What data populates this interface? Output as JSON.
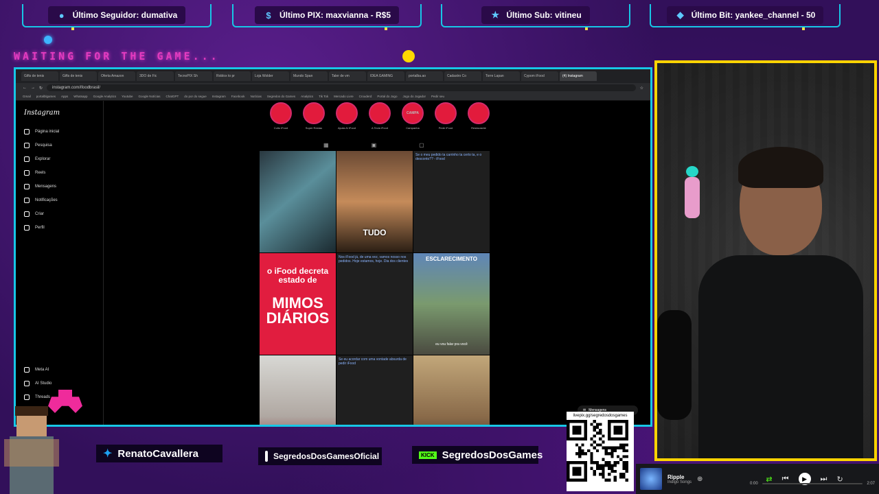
{
  "alerts": [
    {
      "icon": "user-icon",
      "label": "Último Seguidor: dumativa"
    },
    {
      "icon": "dollar-icon",
      "label": "Último PIX: maxvianna - R$5"
    },
    {
      "icon": "star-icon",
      "label": "Último Sub: vitineu"
    },
    {
      "icon": "diamond-icon",
      "label": "Último Bit: yankee_channel - 50"
    }
  ],
  "waiting_text": "WAITING FOR THE GAME...",
  "browser": {
    "tabs": [
      "Gifts de tenis",
      "Gifts de tenis",
      "Oferta Amazon",
      "3DO de Fic",
      "TecnoPIX Sh",
      "Roblox to pr",
      "Loja Wolder",
      "Mundo Span",
      "Taler de vm",
      "IDEA GAMING",
      "portalba.ao",
      "Cadastro Co",
      "Torre Lapan",
      "Cypom iFood",
      "(4) Instagram"
    ],
    "url": "instagram.com/ifoodbrasil/",
    "bookmarks": [
      "Gmail",
      "portalblgames",
      "Apps",
      "Whatsapp",
      "Google Analytics",
      "Youtube",
      "Google Notícias",
      "ChatGPT",
      "do por do segue",
      "Instagram",
      "Facebook",
      "Notícias",
      "Segredos do Games",
      "Analytics",
      "Tik Tok",
      "Mercado Livre",
      "Crouderd",
      "Portal do Jogo",
      "Jogo do Jogador",
      "Pedir seu"
    ]
  },
  "instagram": {
    "logo": "Instagram",
    "nav": [
      {
        "icon": "home-icon",
        "label": "Página inicial"
      },
      {
        "icon": "search-icon",
        "label": "Pesquisa"
      },
      {
        "icon": "compass-icon",
        "label": "Explorar"
      },
      {
        "icon": "reels-icon",
        "label": "Reels"
      },
      {
        "icon": "message-icon",
        "label": "Mensagens"
      },
      {
        "icon": "heart-icon",
        "label": "Notificações"
      },
      {
        "icon": "plus-icon",
        "label": "Criar"
      },
      {
        "icon": "profile-icon",
        "label": "Perfil"
      }
    ],
    "nav_bottom": [
      {
        "icon": "meta-ai-icon",
        "label": "Meta AI"
      },
      {
        "icon": "ai-studio-icon",
        "label": "AI Studio"
      },
      {
        "icon": "threads-icon",
        "label": "Threads"
      }
    ],
    "stories": [
      "Culto iFood",
      "Super Restau",
      "Ajuda AI iFood",
      "A Tecla iFood",
      "Campanha",
      "Pede iFood",
      "Restaurante"
    ],
    "story_badges": [
      "",
      "",
      "",
      "",
      "CAMPA",
      "",
      ""
    ],
    "posts": [
      {
        "kind": "image",
        "caption": ""
      },
      {
        "kind": "image",
        "caption": "TUDO"
      },
      {
        "kind": "text",
        "caption": "Se o meu pedido ta carrinho ta certo ta, e o desconto?? - iFood"
      },
      {
        "kind": "text-big",
        "line1": "o iFood decreta estado de",
        "line2": "MIMOS DIÁRIOS"
      },
      {
        "kind": "text",
        "caption": "Nos iFood já, de uma vez, vamos nosso nos pedidos. Hoje estamos, hoje. Dia dos clientes"
      },
      {
        "kind": "image",
        "caption": "ESCLARECIMENTO",
        "subtitle": "eu vou falar pra você"
      },
      {
        "kind": "image",
        "caption": ""
      },
      {
        "kind": "text",
        "caption": "Se eu acordar com uma vontade absurda de pedir iFood"
      },
      {
        "kind": "image",
        "caption": ""
      }
    ],
    "messages_label": "Mensagens"
  },
  "socials": {
    "twitter": "RenatoCavallera",
    "instagram": "SegredosDosGamesOficial",
    "kick_logo": "KICK",
    "kick": "SegredosDosGames"
  },
  "qr_url": "livepix.gg/segredosdosgames",
  "player": {
    "title": "Ripple",
    "artist": "Indigo Songs",
    "current": "0:00",
    "total": "2:07",
    "progress": 0
  },
  "colors": {
    "frame": "#17c7e6",
    "cam_border": "#ffd400",
    "accent_pink": "#e23bbf",
    "ifood_red": "#e11d3f"
  }
}
